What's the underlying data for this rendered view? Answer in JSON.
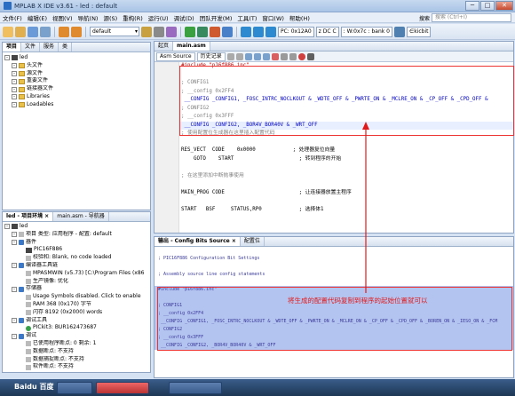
{
  "window": {
    "title": "MPLAB X IDE v3.61 - led : default",
    "min": "─",
    "max": "□",
    "close": "✕"
  },
  "menu": [
    "文件(F)",
    "编辑(E)",
    "视图(V)",
    "导航(N)",
    "源(S)",
    "重构(R)",
    "运行(U)",
    "调试(D)",
    "团队开发(M)",
    "工具(T)",
    "窗口(W)",
    "帮助(H)"
  ],
  "search": {
    "label": "搜索",
    "placeholder": "搜索 (Ctrl+I)"
  },
  "toolbar": {
    "config_select": "default",
    "pc": "PC: 0x12A0",
    "status_bits": "z DC C",
    "w_bank": ": W:0x7c : bank 0",
    "clock": "∈kicbit"
  },
  "projects": {
    "tabs": [
      "项目",
      "文件",
      "服务",
      "类"
    ],
    "tree": [
      {
        "level": 0,
        "text": "led",
        "icon": "chip"
      },
      {
        "level": 1,
        "text": "头文件",
        "icon": "folder"
      },
      {
        "level": 1,
        "text": "源文件",
        "icon": "folder"
      },
      {
        "level": 1,
        "text": "重要文件",
        "icon": "folder"
      },
      {
        "level": 1,
        "text": "链接器文件",
        "icon": "folder"
      },
      {
        "level": 1,
        "text": "Libraries",
        "icon": "folder"
      },
      {
        "level": 1,
        "text": "Loadables",
        "icon": "folder"
      }
    ]
  },
  "dashboard": {
    "tabs": [
      "led - 项目环境 ×",
      "main.asm - 导航器"
    ],
    "tree": [
      {
        "level": 0,
        "text": "led",
        "icon": "chip"
      },
      {
        "level": 1,
        "text": "项目 类型: 应用程序 - 配置: default",
        "icon": "grey"
      },
      {
        "level": 1,
        "text": "器件",
        "icon": "blue"
      },
      {
        "level": 2,
        "text": "PIC16F886",
        "icon": "chip"
      },
      {
        "level": 2,
        "text": "校验和: Blank, no code loaded",
        "icon": "grey"
      },
      {
        "level": 1,
        "text": "编译器工具链",
        "icon": "blue"
      },
      {
        "level": 2,
        "text": "MPASMWIN (v5.73) [C:\\Program Files (x86",
        "icon": "grey"
      },
      {
        "level": 2,
        "text": "生产镜像: 优化",
        "icon": "grey"
      },
      {
        "level": 1,
        "text": "存储器",
        "icon": "blue"
      },
      {
        "level": 2,
        "text": "Usage Symbols disabled. Click to enable",
        "icon": "grey"
      },
      {
        "level": 2,
        "text": "RAM 368 (0x170) 字节",
        "icon": "grey"
      },
      {
        "level": 2,
        "text": "闪存 8192 (0x2000) words",
        "icon": "grey"
      },
      {
        "level": 1,
        "text": "调试工具",
        "icon": "blue"
      },
      {
        "level": 2,
        "text": "PICkit3: BUR162473687",
        "icon": "green"
      },
      {
        "level": 1,
        "text": "调试",
        "icon": "blue"
      },
      {
        "level": 2,
        "text": "已使用程序断点: 0  剩余: 1",
        "icon": "grey"
      },
      {
        "level": 2,
        "text": "数据断点: 不支持",
        "icon": "grey"
      },
      {
        "level": 2,
        "text": "数据捕捉断点: 不支持",
        "icon": "grey"
      },
      {
        "level": 2,
        "text": "软件断点: 不支持",
        "icon": "grey"
      }
    ]
  },
  "editor": {
    "tabs": [
      "起页",
      "main.asm"
    ],
    "subtabs": [
      "Asm Source",
      "历史记录"
    ],
    "lines": [
      {
        "n": "",
        "text": "#include \"p16f886.inc\""
      },
      {
        "n": "2",
        "text": ""
      },
      {
        "n": "3",
        "text": "; CONFIG1"
      },
      {
        "n": "4",
        "text": "; __config 0x2FF4"
      },
      {
        "n": "5",
        "text": " __CONFIG _CONFIG1, _FOSC_INTRC_NOCLKOUT & _WDTE_OFF & _PWRTE_ON & _MCLRE_ON & _CP_OFF & _CPD_OFF &"
      },
      {
        "n": "6",
        "text": "; CONFIG2"
      },
      {
        "n": "7",
        "text": "; __config 0x3FFF"
      },
      {
        "n": "8",
        "text": " __CONFIG _CONFIG2, _BOR4V_BOR40V & _WRT_OFF"
      },
      {
        "n": "9",
        "text": "; 使用配置位生成器在这里插入配置代码"
      },
      {
        "n": "10",
        "text": ""
      },
      {
        "n": "11",
        "text": "RES_VECT  CODE    0x0000            ; 处理器复位向量"
      },
      {
        "n": "12",
        "text": "    GOTO    START                     ; 转到程序的开始"
      },
      {
        "n": "13",
        "text": ""
      },
      {
        "n": "14",
        "text": "; 在这里添加中断抛事使用"
      },
      {
        "n": "15",
        "text": ""
      },
      {
        "n": "16",
        "text": "MAIN_PROG CODE                        ; 让连接器放置主程序"
      },
      {
        "n": "17",
        "text": ""
      },
      {
        "n": "18",
        "text": "START   BSF     STATUS,RP0            ; 选择体1"
      }
    ]
  },
  "output": {
    "tabs": [
      "输出 - Config Bits Source ×",
      "配置位"
    ],
    "lines": [
      "",
      "; PIC16F886 Configuration Bit Settings",
      "",
      "; Assembly source line config statements",
      "",
      "#include \"p16f886.inc\"",
      "",
      "; CONFIG1",
      "; __config 0x2FF4",
      " __CONFIG _CONFIG1, _FOSC_INTRC_NOCLKOUT & _WDTE_OFF & _PWRTE_ON & _MCLRE_ON & _CP_OFF & _CPD_OFF & _BOREN_ON & _IESO_ON & _FCM",
      "; CONFIG2",
      "; __config 0x3FFF",
      " __CONFIG _CONFIG2, _BOR4V_BOR40V & _WRT_OFF",
      ""
    ],
    "annotation": "将生成的配置代码复制到程序的起始位置就可以"
  },
  "taskbar": [
    "Baidu 百度",
    "",
    "",
    ""
  ]
}
